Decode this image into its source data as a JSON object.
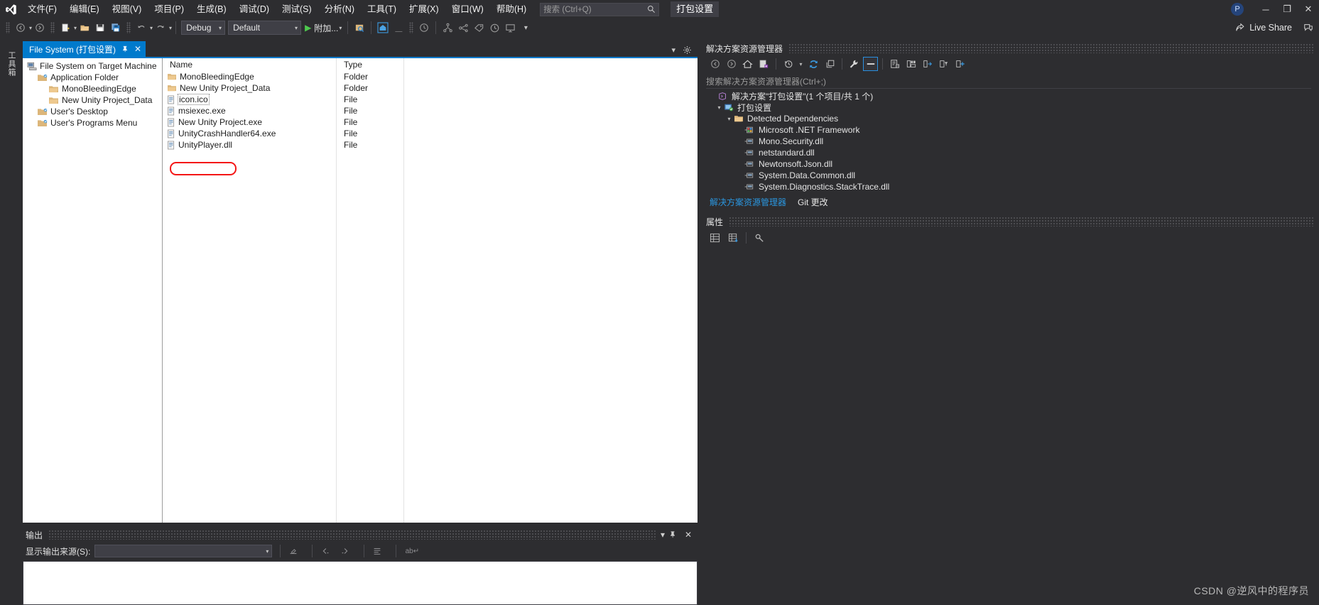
{
  "app": {
    "title": "打包设置",
    "account_initial": "P",
    "live_share": "Live Share"
  },
  "menu": {
    "items": [
      {
        "label": "文件(F)"
      },
      {
        "label": "编辑(E)"
      },
      {
        "label": "视图(V)"
      },
      {
        "label": "项目(P)"
      },
      {
        "label": "生成(B)"
      },
      {
        "label": "调试(D)"
      },
      {
        "label": "测试(S)"
      },
      {
        "label": "分析(N)"
      },
      {
        "label": "工具(T)"
      },
      {
        "label": "扩展(X)"
      },
      {
        "label": "窗口(W)"
      },
      {
        "label": "帮助(H)"
      }
    ]
  },
  "search": {
    "placeholder": "搜索 (Ctrl+Q)",
    "icon": "search-icon"
  },
  "window_controls": {
    "minimize": "─",
    "restore": "❐",
    "close": "✕",
    "pin": "pin-icon"
  },
  "toolbar": {
    "nav_back": "back-icon",
    "nav_forward": "forward-icon",
    "new_item": "new-item-icon",
    "open": "open-folder-icon",
    "save": "save-icon",
    "save_all": "save-all-icon",
    "undo": "undo-icon",
    "redo": "redo-icon",
    "config": "Debug",
    "platform": "Default",
    "run_label": "附加...",
    "preview": "preview-icon",
    "home": "home-icon",
    "history": "history-icon",
    "hierarchy": "hierarchy-icon",
    "branch": "branch-icon",
    "tag": "tag-icon",
    "clock": "clock-icon",
    "monitor": "monitor-icon"
  },
  "left_vertical_tab": {
    "label": "工具箱"
  },
  "designer": {
    "tab": {
      "label": "File System (打包设置)",
      "pin_icon": "pin-icon",
      "close_icon": "close-icon"
    },
    "tools": {
      "dropdown_icon": "chevron-down-icon",
      "gear_icon": "gear-icon"
    },
    "tree": {
      "nodes": [
        {
          "label": "File System on Target Machine",
          "indent": 0,
          "icon": "computer-icon"
        },
        {
          "label": "Application Folder",
          "indent": 1,
          "icon": "special-folder-icon"
        },
        {
          "label": "MonoBleedingEdge",
          "indent": 2,
          "icon": "folder-icon"
        },
        {
          "label": "New Unity Project_Data",
          "indent": 2,
          "icon": "folder-icon"
        },
        {
          "label": "User's Desktop",
          "indent": 1,
          "icon": "special-folder-icon"
        },
        {
          "label": "User's Programs Menu",
          "indent": 1,
          "icon": "special-folder-icon"
        }
      ]
    },
    "list": {
      "columns": [
        "Name",
        "Type"
      ],
      "rows": [
        {
          "name": "MonoBleedingEdge",
          "type": "Folder",
          "icon": "folder-icon",
          "state": "normal"
        },
        {
          "name": "New Unity Project_Data",
          "type": "Folder",
          "icon": "folder-icon",
          "state": "normal"
        },
        {
          "name": "icon.ico",
          "type": "File",
          "icon": "file-icon",
          "state": "focused"
        },
        {
          "name": "msiexec.exe",
          "type": "File",
          "icon": "file-icon",
          "state": "highlighted"
        },
        {
          "name": "New Unity Project.exe",
          "type": "File",
          "icon": "file-icon",
          "state": "normal"
        },
        {
          "name": "UnityCrashHandler64.exe",
          "type": "File",
          "icon": "file-icon",
          "state": "normal"
        },
        {
          "name": "UnityPlayer.dll",
          "type": "File",
          "icon": "file-icon",
          "state": "normal"
        }
      ],
      "highlight_color": "#f41616"
    }
  },
  "output_panel": {
    "title": "输出",
    "source_label": "显示输出来源(S):",
    "source_value": "",
    "buttons": {
      "dropdown": "chevron-down-icon",
      "pin": "pin-icon",
      "close": "close-icon"
    },
    "toolbar_icons": [
      "clear-all-icon",
      "go-to-previous-icon",
      "go-to-next-icon",
      "toggle-wordwrap-icon",
      "find-icon"
    ]
  },
  "solution_explorer": {
    "title": "解决方案资源管理器",
    "search_placeholder": "搜索解决方案资源管理器(Ctrl+;)",
    "toolbar_icons": [
      "back-icon",
      "forward-icon",
      "home-icon",
      "pending-changes-icon",
      "history-icon",
      "refresh-icon",
      "collapse-all-icon",
      "properties-wrench-icon",
      "show-all-files-icon",
      "view-code-icon",
      "preview-selected-icon",
      "sync-icon",
      "filter-icon",
      "add-icon"
    ],
    "tree": [
      {
        "label": "解决方案\"打包设置\"(1 个项目/共 1 个)",
        "indent": 0,
        "arrow": "",
        "icon": "solution-icon"
      },
      {
        "label": "打包设置",
        "indent": 1,
        "arrow": "▾",
        "icon": "setup-project-icon"
      },
      {
        "label": "Detected Dependencies",
        "indent": 2,
        "arrow": "▾",
        "icon": "folder-icon"
      },
      {
        "label": "Microsoft .NET Framework",
        "indent": 3,
        "arrow": "",
        "icon": "framework-icon"
      },
      {
        "label": "Mono.Security.dll",
        "indent": 3,
        "arrow": "",
        "icon": "assembly-icon"
      },
      {
        "label": "netstandard.dll",
        "indent": 3,
        "arrow": "",
        "icon": "assembly-icon"
      },
      {
        "label": "Newtonsoft.Json.dll",
        "indent": 3,
        "arrow": "",
        "icon": "assembly-icon"
      },
      {
        "label": "System.Data.Common.dll",
        "indent": 3,
        "arrow": "",
        "icon": "assembly-icon"
      },
      {
        "label": "System.Diagnostics.StackTrace.dll",
        "indent": 3,
        "arrow": "",
        "icon": "assembly-icon"
      }
    ],
    "tabs": [
      {
        "label": "解决方案资源管理器",
        "selected": true
      },
      {
        "label": "Git 更改",
        "selected": false
      }
    ]
  },
  "properties_panel": {
    "title": "属性",
    "toolbar_icons": [
      "categorized-icon",
      "alphabetical-icon",
      "property-pages-icon"
    ]
  },
  "watermark": {
    "text": "CSDN @逆风中的程序员"
  },
  "colors": {
    "accent": "#007acc",
    "chrome": "#2d2d30",
    "panel_bg": "#252526",
    "highlight": "#f41616",
    "link": "#2a96df"
  }
}
